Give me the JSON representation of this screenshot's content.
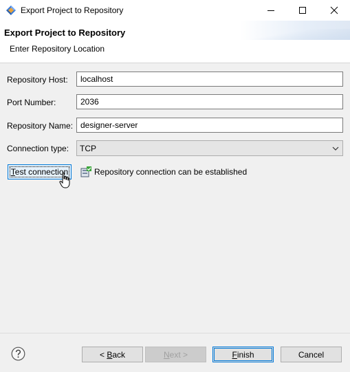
{
  "window": {
    "title": "Export Project to Repository"
  },
  "header": {
    "title": "Export Project to Repository",
    "subtitle": "Enter Repository Location"
  },
  "form": {
    "host_label": "Repository Host:",
    "host_value": "localhost",
    "port_label": "Port Number:",
    "port_value": "2036",
    "name_label": "Repository Name:",
    "name_value": "designer-server",
    "conn_label": "Connection type:",
    "conn_value": "TCP"
  },
  "test": {
    "button_mnemonic": "T",
    "button_rest": "est connection",
    "status": "Repository connection can be established"
  },
  "footer": {
    "back_prefix": "< ",
    "back_mnemonic": "B",
    "back_rest": "ack",
    "next_mnemonic": "N",
    "next_rest": "ext >",
    "finish_mnemonic": "F",
    "finish_rest": "inish",
    "cancel": "Cancel"
  },
  "colors": {
    "accent": "#0078d7",
    "header_bg": "#ffffff",
    "dialog_bg": "#f0f0f0"
  },
  "icons": {
    "app": "eclipse-app-icon",
    "minimize": "minimize-icon",
    "maximize": "maximize-icon",
    "close": "close-icon",
    "dropdown": "chevron-down-icon",
    "status": "repository-ok-icon",
    "help": "help-icon",
    "cursor": "mouse-cursor-icon"
  }
}
